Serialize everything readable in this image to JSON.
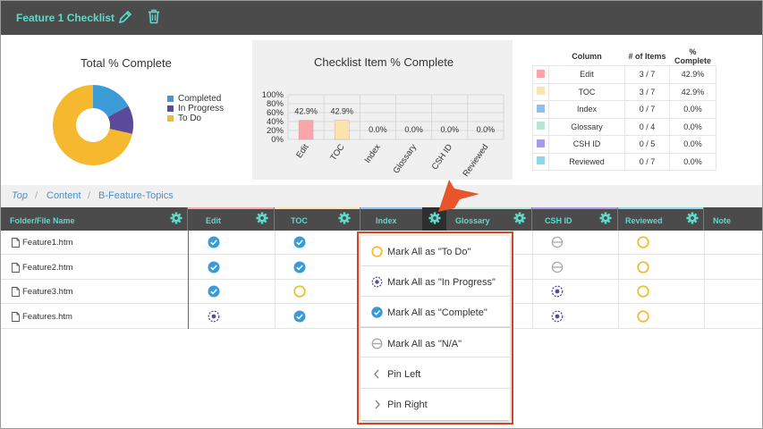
{
  "header": {
    "title": "Feature 1 Checklist",
    "edit_icon": "pencil-icon",
    "delete_icon": "trash-icon"
  },
  "colors": {
    "accent": "#5fd9c8",
    "header_bg": "#4b4b4b",
    "completed": "#3b9bd6",
    "in_progress": "#5a4a99",
    "todo": "#f5b82e",
    "callout": "#d9451e"
  },
  "total_chart": {
    "title": "Total % Complete",
    "legend": [
      "Completed",
      "In Progress",
      "To Do"
    ]
  },
  "chart_data": [
    {
      "type": "pie",
      "title": "Total % Complete",
      "labels": [
        "Completed",
        "In Progress",
        "To Do"
      ],
      "values": [
        17.1,
        11.4,
        71.5
      ],
      "colors": [
        "#3b9bd6",
        "#5a4a99",
        "#f5b82e"
      ],
      "legend": "right",
      "donut": true
    },
    {
      "type": "bar",
      "title": "Checklist Item % Complete",
      "categories": [
        "Edit",
        "TOC",
        "Index",
        "Glossary",
        "CSH ID",
        "Reviewed"
      ],
      "values": [
        42.9,
        42.9,
        0.0,
        0.0,
        0.0,
        0.0
      ],
      "value_labels": [
        "42.9%",
        "42.9%",
        "0.0%",
        "0.0%",
        "0.0%",
        "0.0%"
      ],
      "yticks": [
        "100%",
        "80%",
        "60%",
        "40%",
        "20%",
        "0%"
      ],
      "ylim": [
        0,
        100
      ],
      "bar_colors": [
        "#f9a5a9",
        "#fde3ad",
        "#8fbff0",
        "#b8e6d2",
        "#a99ae8",
        "#8dd9ea"
      ],
      "grid": true
    }
  ],
  "status_table": {
    "headers": [
      "Column",
      "# of Items",
      "% Complete"
    ],
    "rows": [
      {
        "column": "Edit",
        "items": "3 / 7",
        "pct": "42.9%",
        "color": "#f9a5a9"
      },
      {
        "column": "TOC",
        "items": "3 / 7",
        "pct": "42.9%",
        "color": "#fde3ad"
      },
      {
        "column": "Index",
        "items": "0 / 7",
        "pct": "0.0%",
        "color": "#8fbff0"
      },
      {
        "column": "Glossary",
        "items": "0 / 4",
        "pct": "0.0%",
        "color": "#b8e6d2"
      },
      {
        "column": "CSH ID",
        "items": "0 / 5",
        "pct": "0.0%",
        "color": "#a99ae8"
      },
      {
        "column": "Reviewed",
        "items": "0 / 7",
        "pct": "0.0%",
        "color": "#8dd9ea"
      }
    ]
  },
  "breadcrumb": [
    "Top",
    "Content",
    "B-Feature-Topics"
  ],
  "grid": {
    "columns": [
      "Folder/File Name",
      "Edit",
      "TOC",
      "Index",
      "Glossary",
      "CSH ID",
      "Reviewed",
      "Note"
    ],
    "rows": [
      {
        "file": "Feature1.htm",
        "status": [
          "complete",
          "complete",
          "todo",
          "na",
          "na",
          "todo"
        ]
      },
      {
        "file": "Feature2.htm",
        "status": [
          "complete",
          "complete",
          "todo",
          "na",
          "na",
          "todo"
        ]
      },
      {
        "file": "Feature3.htm",
        "status": [
          "complete",
          "todo",
          "todo",
          "na",
          "progress",
          "todo"
        ]
      },
      {
        "file": "Features.htm",
        "status": [
          "progress",
          "complete",
          "todo",
          "na",
          "progress",
          "todo"
        ]
      }
    ]
  },
  "context_menu": {
    "items": [
      {
        "label": "Mark All as \"To Do\"",
        "icon": "todo-circle-icon"
      },
      {
        "label": "Mark All as \"In Progress\"",
        "icon": "in-progress-icon"
      },
      {
        "label": "Mark All as \"Complete\"",
        "icon": "check-circle-icon"
      },
      {
        "label": "Mark All as \"N/A\"",
        "icon": "na-circle-icon"
      },
      {
        "label": "Pin Left",
        "icon": "chevron-left-icon"
      },
      {
        "label": "Pin Right",
        "icon": "chevron-right-icon"
      }
    ]
  }
}
